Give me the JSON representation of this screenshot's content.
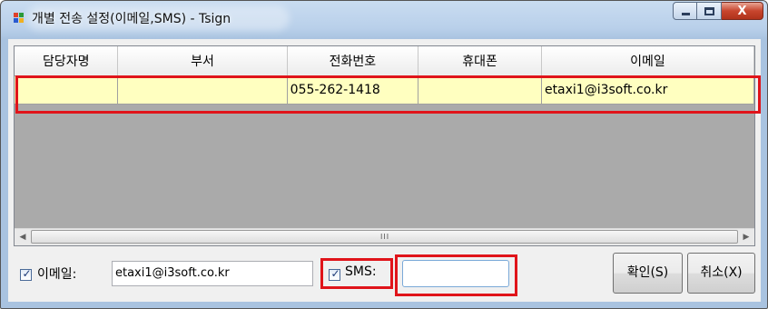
{
  "window": {
    "title": "개별 전송 설정(이메일,SMS) - Tsign",
    "controls": {
      "minimize": "—",
      "maximize": "□",
      "close": "X"
    }
  },
  "grid": {
    "columns": [
      "담당자명",
      "부서",
      "전화번호",
      "휴대폰",
      "이메일"
    ],
    "rows": [
      {
        "name": "",
        "dept": "",
        "phone": "055-262-1418",
        "mobile": "",
        "email": "etaxi1@i3soft.co.kr"
      }
    ],
    "scroll_left": "◀",
    "scroll_right": "▶",
    "scroll_grip": "III"
  },
  "form": {
    "email_checked": true,
    "email_label": "이메일:",
    "email_value": "etaxi1@i3soft.co.kr",
    "sms_checked": true,
    "sms_label": "SMS:",
    "sms_value": "",
    "checkmark": "✓",
    "ok_label": "확인(S)",
    "cancel_label": "취소(X)"
  },
  "colors": {
    "highlight": "#e0141a",
    "row_background": "#ffffc0",
    "grid_empty": "#aaaaaa"
  }
}
